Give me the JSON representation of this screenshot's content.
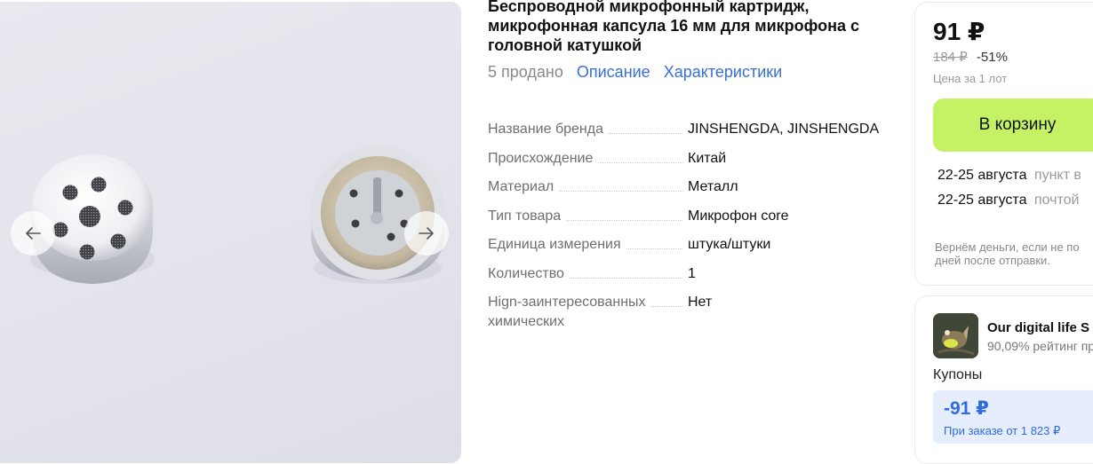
{
  "product": {
    "title": "Беспроводной микрофонный картридж, микрофонная капсула 16 мм для микрофона с головной катушкой",
    "sold": "5 продано",
    "tabs": [
      "Описание",
      "Характеристики"
    ]
  },
  "specs": [
    {
      "name": "Название бренда",
      "value": "JINSHENGDA, JINSHENGDA"
    },
    {
      "name": "Происхождение",
      "value": "Китай"
    },
    {
      "name": "Материал",
      "value": "Металл"
    },
    {
      "name": "Тип товара",
      "value": "Микрофон core"
    },
    {
      "name": "Единица измерения",
      "value": "штука/штуки"
    },
    {
      "name": "Количество",
      "value": "1"
    },
    {
      "name_line1": "Hign-заинтересованных",
      "name_line2": "химических",
      "value": "Нет"
    }
  ],
  "buy": {
    "price": "91 ₽",
    "old_price": "184 ₽",
    "discount": "-51%",
    "per_lot": "Цена за 1 лот",
    "cart_label": "В корзину",
    "delivery": [
      {
        "date": "22-25 августа",
        "where": "пункт в"
      },
      {
        "date": "22-25 августа",
        "where": "почтой"
      }
    ],
    "refund_line1": "Вернём деньги, если не по",
    "refund_line2": "дней после отправки."
  },
  "seller": {
    "name": "Our digital life S",
    "rating": "90,09% рейтинг пр",
    "coupons_label": "Купоны",
    "coupon_value": "-91 ₽",
    "coupon_condition": "При заказе от 1 823 ₽"
  },
  "colors": {
    "accent_link": "#3670d6",
    "cart_button": "#c5f264",
    "coupon_bg": "#e6edfd"
  },
  "icons": {
    "prev": "arrow-left-icon",
    "next": "arrow-right-icon"
  }
}
